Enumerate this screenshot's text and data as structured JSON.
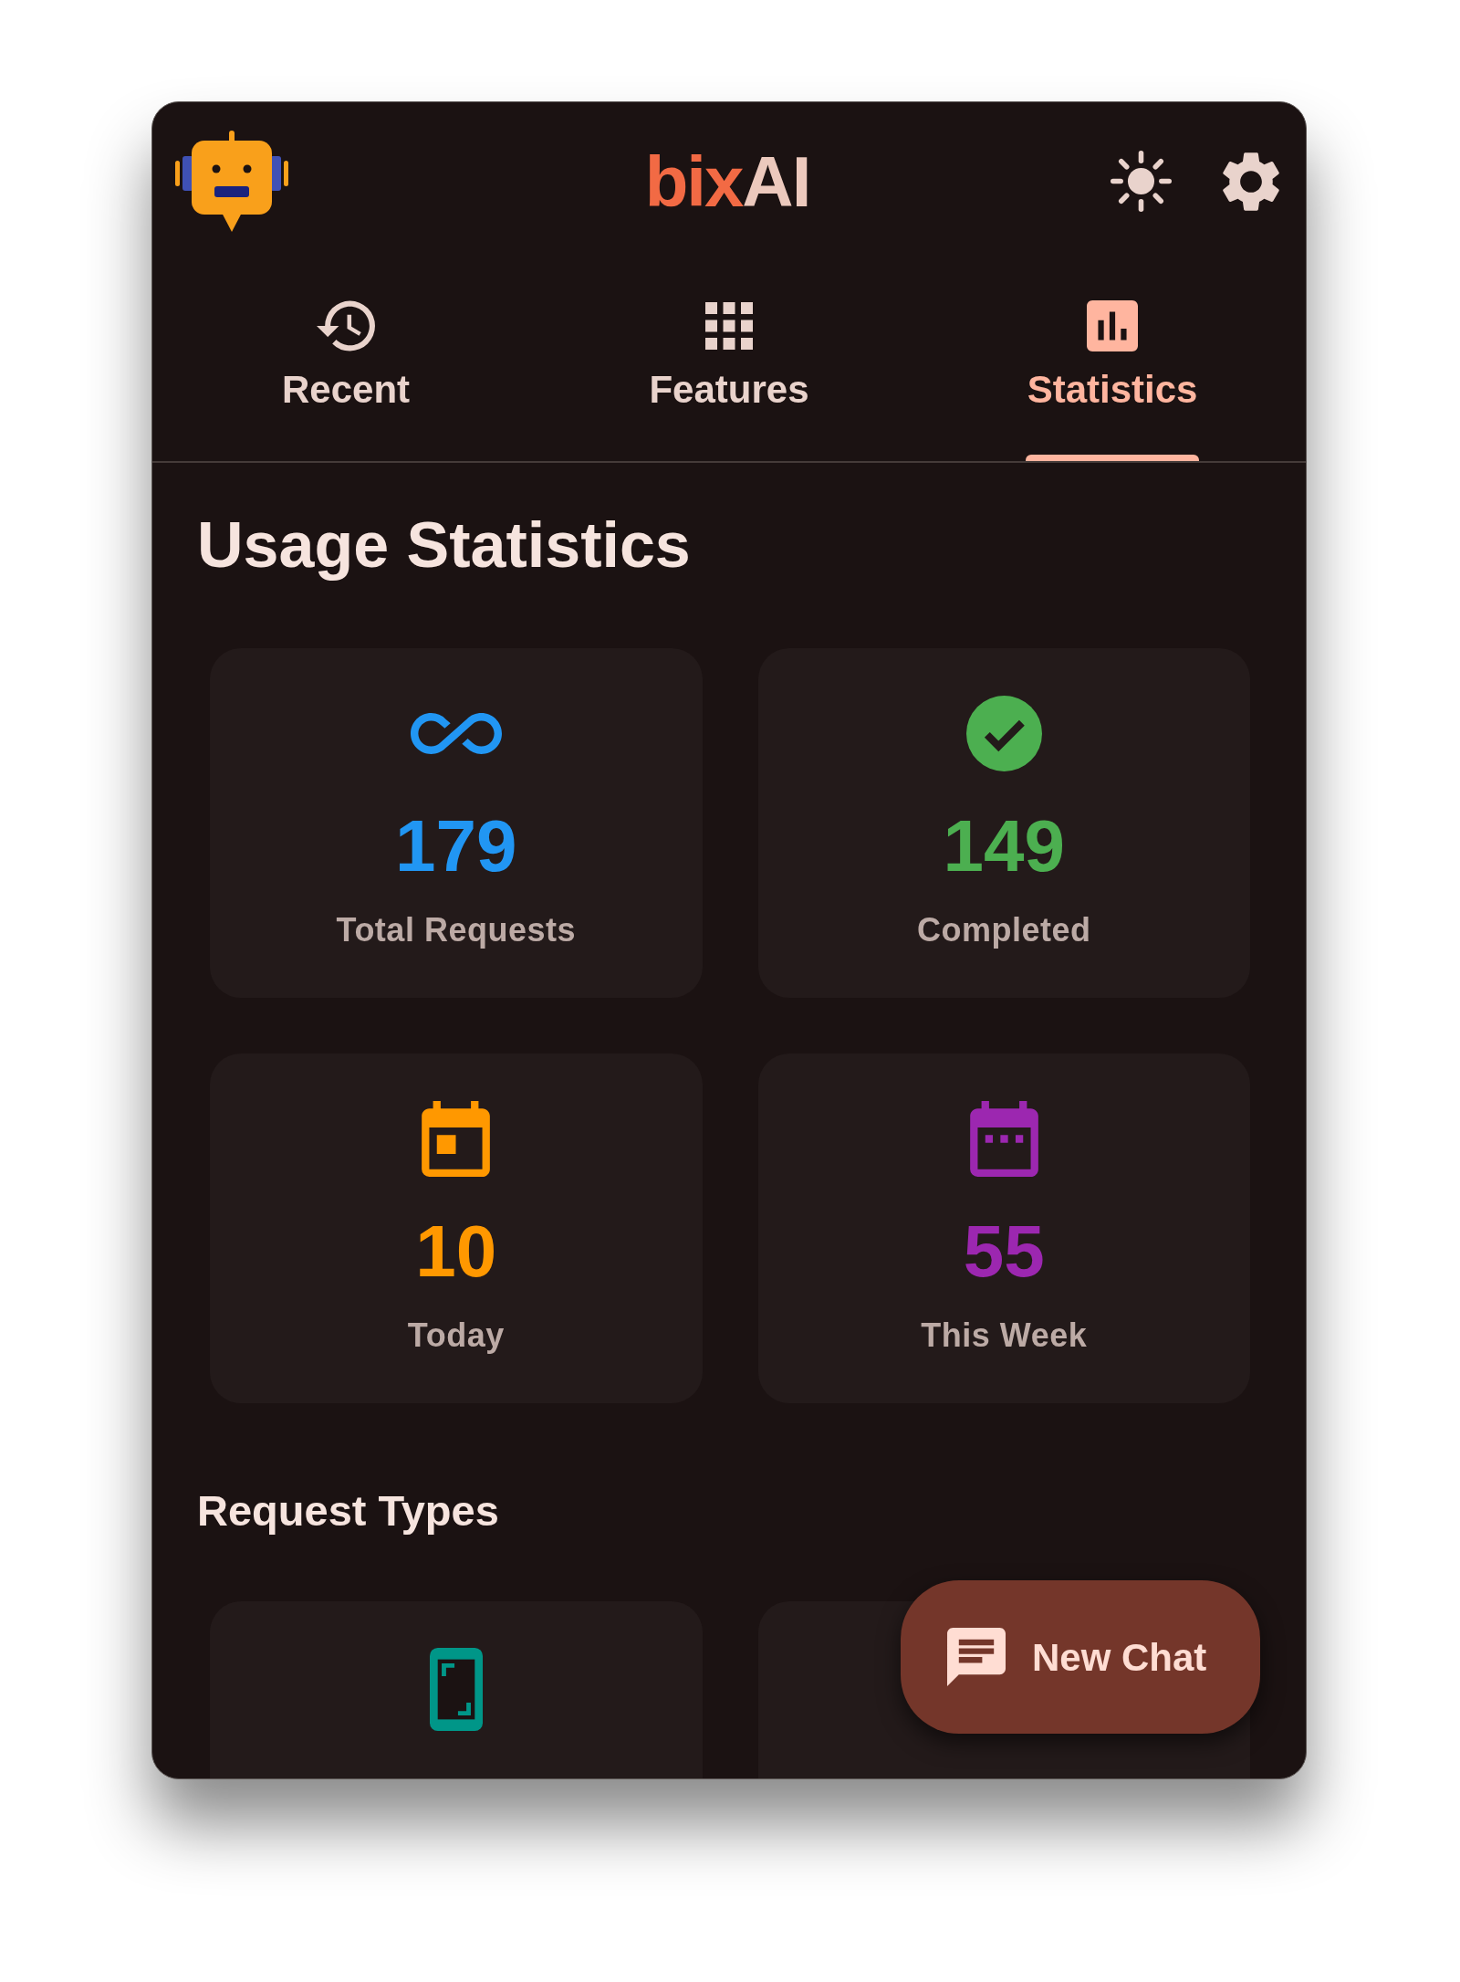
{
  "header": {
    "logo": [
      {
        "text": "bix",
        "color": "#f26a44"
      },
      {
        "text": "AI",
        "color": "#ecc9bd"
      }
    ]
  },
  "tabs": [
    {
      "label": "Recent",
      "kind": "history",
      "selected": false
    },
    {
      "label": "Features",
      "kind": "grid",
      "selected": false
    },
    {
      "label": "Statistics",
      "kind": "chart",
      "selected": true
    }
  ],
  "usage": {
    "title": "Usage Statistics",
    "cards": [
      {
        "kind": "infinity",
        "value": "179",
        "label": "Total Requests",
        "color": "#2196f3"
      },
      {
        "kind": "check",
        "value": "149",
        "label": "Completed",
        "color": "#4caf50"
      },
      {
        "kind": "day",
        "value": "10",
        "label": "Today",
        "color": "#ff9800"
      },
      {
        "kind": "week",
        "value": "55",
        "label": "This Week",
        "color": "#9c27b0"
      }
    ]
  },
  "request_types": {
    "title": "Request Types",
    "cards": [
      {
        "kind": "screenshot",
        "color": "#009688"
      },
      {
        "kind": "blank"
      }
    ]
  },
  "new_chat_button": {
    "label": "New Chat"
  }
}
